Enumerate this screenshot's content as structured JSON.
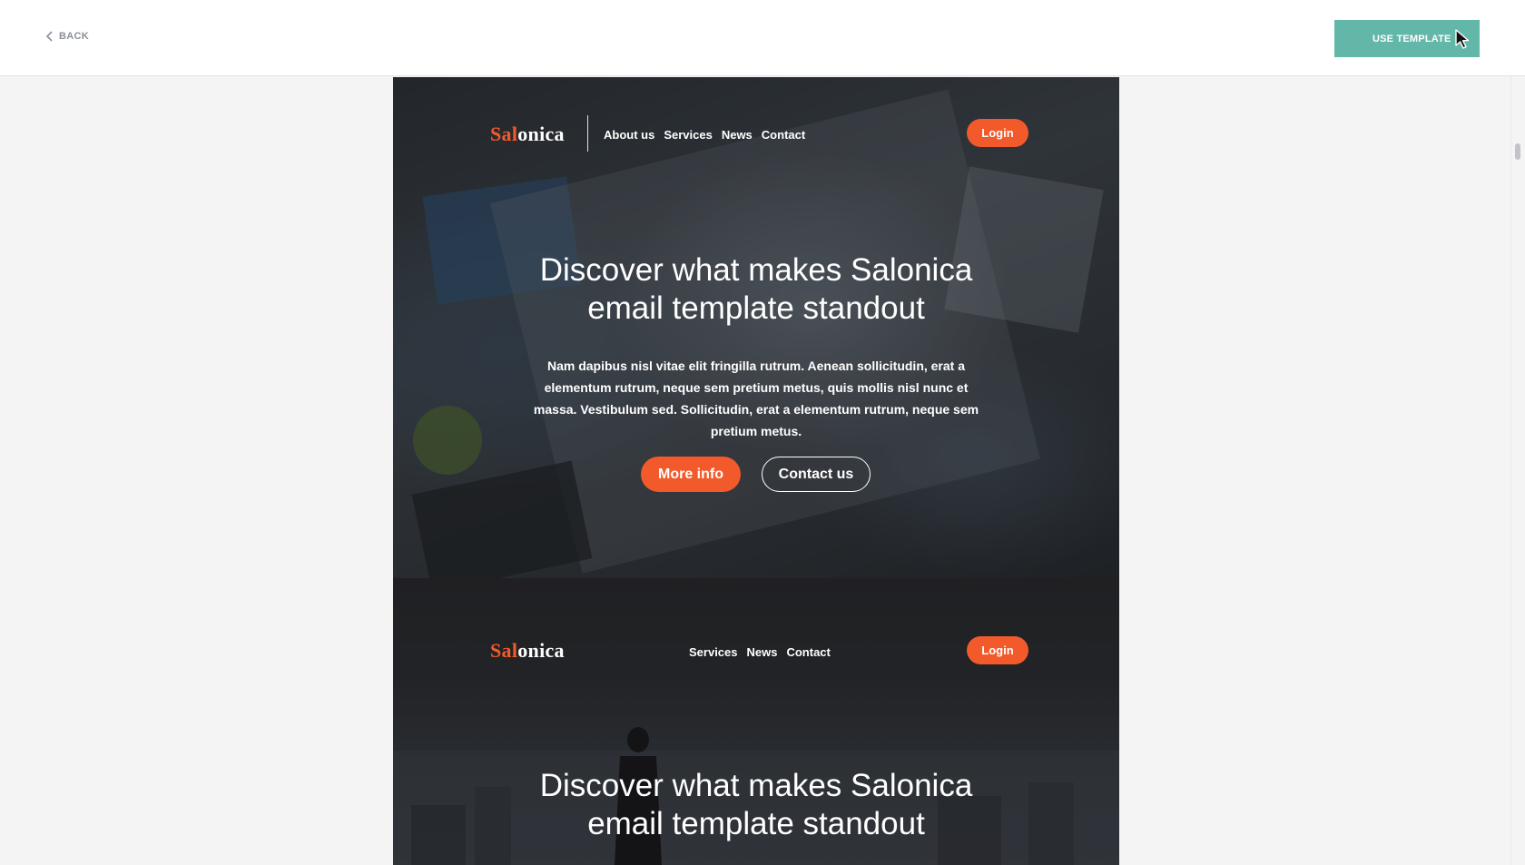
{
  "topbar": {
    "back_label": "BACK",
    "use_template_label": "USE TEMPLATE"
  },
  "colors": {
    "accent": "#f25a2b",
    "teal": "#63b7a8"
  },
  "section1": {
    "brand_accent": "Sal",
    "brand_rest": "onica",
    "nav": [
      "About us",
      "Services",
      "News",
      "Contact"
    ],
    "login_label": "Login",
    "headline_line1": "Discover what makes Salonica",
    "headline_line2": "email template standout",
    "body_text": "Nam dapibus nisl vitae elit fringilla rutrum. Aenean sollicitudin, erat a elementum rutrum, neque sem pretium metus, quis mollis nisl nunc et massa. Vestibulum sed. Sollicitudin, erat a elementum rutrum, neque sem pretium metus.",
    "more_info_label": "More info",
    "contact_us_label": "Contact us"
  },
  "section2": {
    "brand_accent": "Sal",
    "brand_rest": "onica",
    "nav": [
      "Services",
      "News",
      "Contact"
    ],
    "login_label": "Login",
    "headline_line1": "Discover what makes Salonica",
    "headline_line2": "email template standout"
  }
}
